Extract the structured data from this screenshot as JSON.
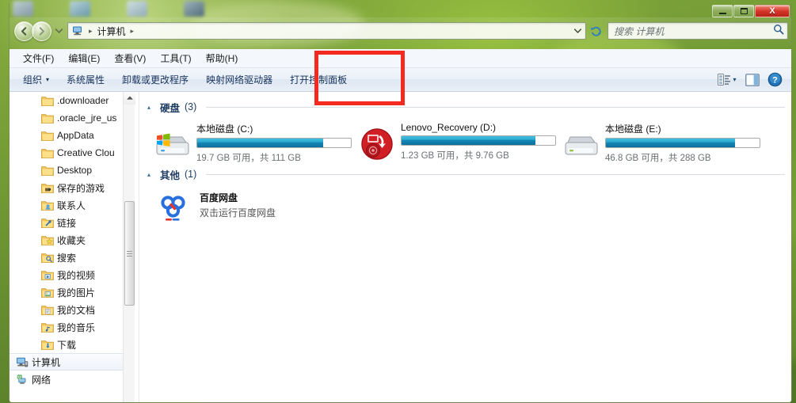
{
  "window": {
    "controls": {
      "minimize": "–",
      "maximize": "□",
      "close": "X"
    }
  },
  "address": {
    "computer_icon": "computer-icon",
    "crumb": "计算机",
    "sep1": "▸",
    "sep2": "▸"
  },
  "search": {
    "placeholder": "搜索 计算机"
  },
  "menubar": {
    "items": [
      {
        "label": "文件(F)"
      },
      {
        "label": "编辑(E)"
      },
      {
        "label": "查看(V)"
      },
      {
        "label": "工具(T)"
      },
      {
        "label": "帮助(H)"
      }
    ]
  },
  "toolbar": {
    "organize": "组织",
    "organize_caret": "▾",
    "items": [
      {
        "label": "系统属性"
      },
      {
        "label": "卸载或更改程序"
      },
      {
        "label": "映射网络驱动器"
      },
      {
        "label": "打开控制面板"
      }
    ],
    "view_caret": "▾"
  },
  "sidebar": {
    "items": [
      {
        "label": ".downloader",
        "icon": "folder-icon",
        "root": false,
        "selected": false
      },
      {
        "label": ".oracle_jre_us",
        "icon": "folder-icon",
        "root": false,
        "selected": false
      },
      {
        "label": "AppData",
        "icon": "folder-icon",
        "root": false,
        "selected": false
      },
      {
        "label": "Creative Clou",
        "icon": "folder-icon",
        "root": false,
        "selected": false
      },
      {
        "label": "Desktop",
        "icon": "folder-icon",
        "root": false,
        "selected": false
      },
      {
        "label": "保存的游戏",
        "icon": "saved-games-icon",
        "root": false,
        "selected": false
      },
      {
        "label": "联系人",
        "icon": "contacts-icon",
        "root": false,
        "selected": false
      },
      {
        "label": "链接",
        "icon": "links-icon",
        "root": false,
        "selected": false
      },
      {
        "label": "收藏夹",
        "icon": "favorites-icon",
        "root": false,
        "selected": false
      },
      {
        "label": "搜索",
        "icon": "searches-icon",
        "root": false,
        "selected": false
      },
      {
        "label": "我的视频",
        "icon": "videos-icon",
        "root": false,
        "selected": false
      },
      {
        "label": "我的图片",
        "icon": "pictures-icon",
        "root": false,
        "selected": false
      },
      {
        "label": "我的文档",
        "icon": "documents-icon",
        "root": false,
        "selected": false
      },
      {
        "label": "我的音乐",
        "icon": "music-icon",
        "root": false,
        "selected": false
      },
      {
        "label": "下载",
        "icon": "downloads-icon",
        "root": false,
        "selected": false
      },
      {
        "label": "计算机",
        "icon": "computer-icon",
        "root": true,
        "selected": true
      },
      {
        "label": "网络",
        "icon": "network-icon",
        "root": true,
        "selected": false
      }
    ]
  },
  "content": {
    "groups": [
      {
        "title": "硬盘",
        "count": "(3)",
        "triangle": "▴",
        "type": "drives",
        "drives": [
          {
            "name": "本地磁盘 (C:)",
            "free_text": "19.7 GB 可用，共 111 GB",
            "used_pct": 82,
            "icon": "system-drive-icon"
          },
          {
            "name": "Lenovo_Recovery (D:)",
            "free_text": "1.23 GB 可用，共 9.76 GB",
            "used_pct": 87,
            "icon": "recovery-drive-icon"
          },
          {
            "name": "本地磁盘 (E:)",
            "free_text": "46.8 GB 可用，共 288 GB",
            "used_pct": 84,
            "icon": "local-drive-icon"
          }
        ]
      },
      {
        "title": "其他",
        "count": "(1)",
        "triangle": "▴",
        "type": "others",
        "others": [
          {
            "name": "百度网盘",
            "desc": "双击运行百度网盘",
            "icon": "baidu-netdisk-icon"
          }
        ]
      }
    ]
  },
  "colors": {
    "accent_blue": "#1689b6",
    "highlight_red": "#f42a20",
    "close_red": "#d7362a",
    "group_header": "#1f3d63"
  }
}
